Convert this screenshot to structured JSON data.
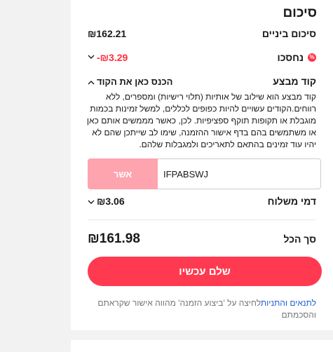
{
  "summary": {
    "title": "סיכום",
    "subtotal_label": "סיכום ביניים",
    "subtotal_value": "₪162.21",
    "discount_label": "נחסכו",
    "discount_icon_glyph": "%",
    "discount_value": "-₪3.29",
    "promo_label": "קוד מבצע",
    "promo_toggle": "הכנס כאן את הקוד",
    "promo_description": "קוד מבצע הוא שילוב של אותיות (תלוי רישיות) ומספרים, ללא רווחים.הקודים עשויים להיות כפופים לכללים, למשל זמינות בכמות מוגבלת או תקופות תוקף ספציפיות. לכן, כאשר מממשים אותם כאן או משתמשים בהם בדף אישור ההזמנה, שימו לב שייתכן שהם לא יהיו עוד זמינים בהתאם לתאריכים ולמגבלות שלהם.",
    "promo_input_value": "IFPABSWJ",
    "apply_label": "אשר",
    "shipping_label": "דמי משלוח",
    "shipping_value": "₪3.06",
    "total_label": "סך הכל",
    "total_value": "₪161.98",
    "pay_label": "שלם עכשיו",
    "terms_link": "לתנאים והתניות",
    "terms_text": "לחיצה על 'ביצוע הזמנה' מהווה אישור שקראתם והסכמתם"
  },
  "colors": {
    "accent": "#ff3a50",
    "discount": "#ff2d3f",
    "apply_disabled": "#fda4ae",
    "link": "#1d5fd6"
  },
  "icons": {
    "discount": "percent-badge-icon",
    "chevron": "chevron-down-icon",
    "chevron_up": "chevron-up-icon"
  }
}
